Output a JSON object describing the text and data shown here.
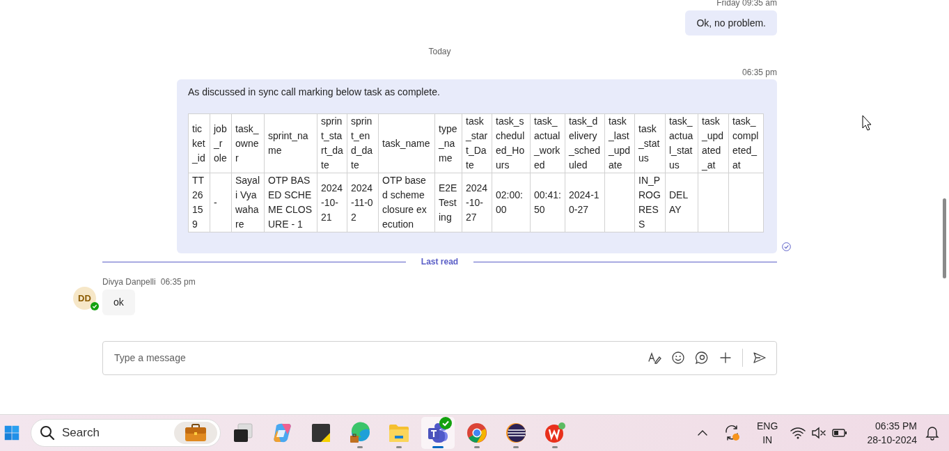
{
  "messages": [
    {
      "kind": "sent",
      "time": "Friday 09:35 am",
      "text": "Ok, no problem."
    },
    {
      "kind": "divider",
      "text": "Today"
    },
    {
      "kind": "sent",
      "time": "06:35 pm",
      "text": "As discussed in sync call marking below task as complete.",
      "read": true,
      "table": {
        "columns": [
          "ticket_id",
          "job_role",
          "task_owner",
          "sprint_name",
          "sprint_start_date",
          "sprint_end_date",
          "task_name",
          "type_name",
          "task_start_Date",
          "task_scheduled_Hours",
          "task_actual_worked",
          "task_delivery_scheduled",
          "task_last_update",
          "task_status",
          "task_actual_status",
          "task_updated_at",
          "task_completed_at"
        ],
        "rows": [
          [
            "TT26159",
            "-",
            "Sayali Vyawahare",
            "OTP BASED SCHEME CLOSURE - 1",
            "2024-10-21",
            "2024-11-02",
            "OTP based scheme closure execution",
            "E2E Testing",
            "2024-10-27",
            "02:00:00",
            "00:41:50",
            "2024-10-27",
            "",
            "IN_PROGRESS",
            "DELAY",
            "",
            ""
          ]
        ]
      }
    },
    {
      "kind": "last_read",
      "text": "Last read"
    },
    {
      "kind": "received",
      "sender": "Divya Danpelli",
      "time": "06:35 pm",
      "initials": "DD",
      "online": true,
      "text": "ok"
    }
  ],
  "composer": {
    "placeholder": "Type a message"
  },
  "taskbar": {
    "search_placeholder": "Search",
    "apps": [
      {
        "selected": false,
        "running": false
      },
      {
        "selected": false,
        "running": false
      },
      {
        "selected": false,
        "running": false
      },
      {
        "selected": false,
        "running": true
      },
      {
        "selected": false,
        "running": true
      },
      {
        "selected": true,
        "running": true,
        "badge": true
      },
      {
        "selected": false,
        "running": true
      },
      {
        "selected": false,
        "running": true
      },
      {
        "selected": false,
        "running": true
      }
    ],
    "language": "ENG",
    "region": "IN",
    "time": "06:35 PM",
    "date": "28-10-2024"
  }
}
